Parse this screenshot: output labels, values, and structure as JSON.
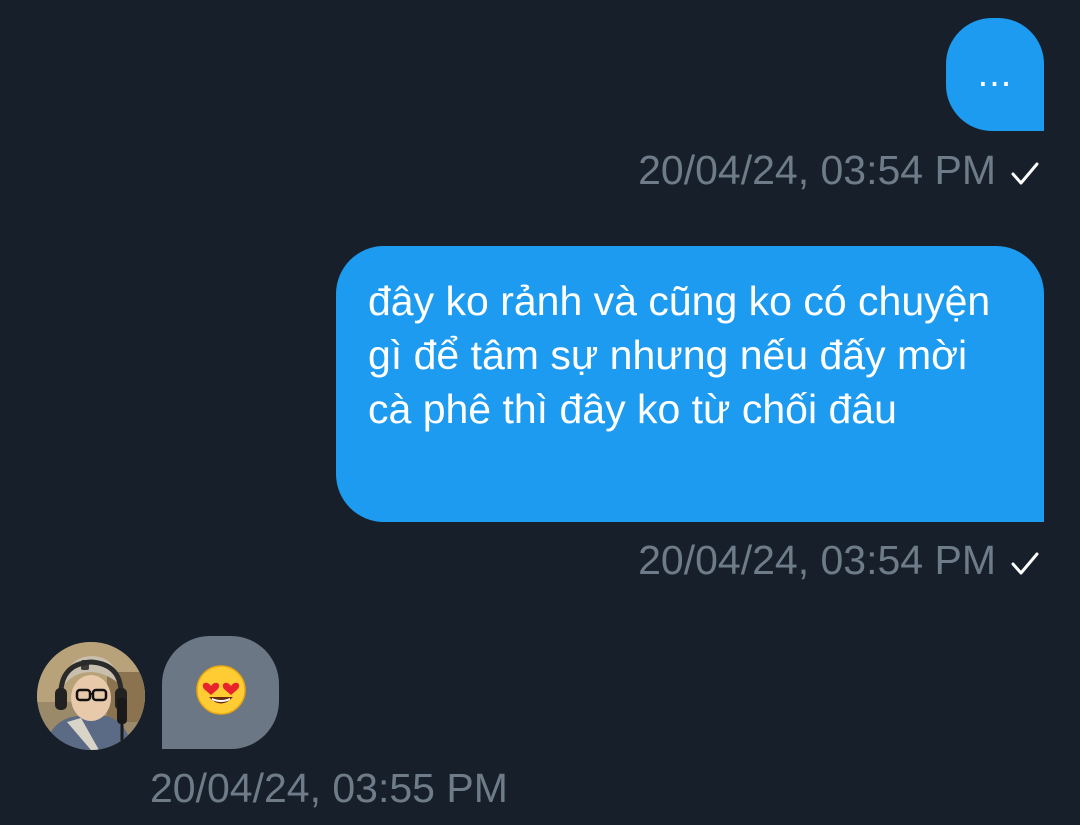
{
  "messages": [
    {
      "direction": "outgoing",
      "text": "...",
      "timestamp": "20/04/24, 03:54 PM",
      "read_icon": "checkmark-icon"
    },
    {
      "direction": "outgoing",
      "text": "đây ko rảnh và cũng ko có chuyện gì để tâm sự nhưng nếu đấy mời cà phê thì đây ko từ chối đâu",
      "timestamp": "20/04/24, 03:54 PM",
      "read_icon": "checkmark-icon"
    },
    {
      "direction": "incoming",
      "emoji": "heart-eyes-emoji",
      "timestamp": "20/04/24, 03:55 PM",
      "avatar_icon": "avatar"
    }
  ],
  "colors": {
    "background": "#17202a",
    "outgoing_bubble": "#1d9bf0",
    "incoming_bubble": "#6b7784",
    "timestamp": "#6e7b88",
    "checkmark": "#ffffff"
  }
}
